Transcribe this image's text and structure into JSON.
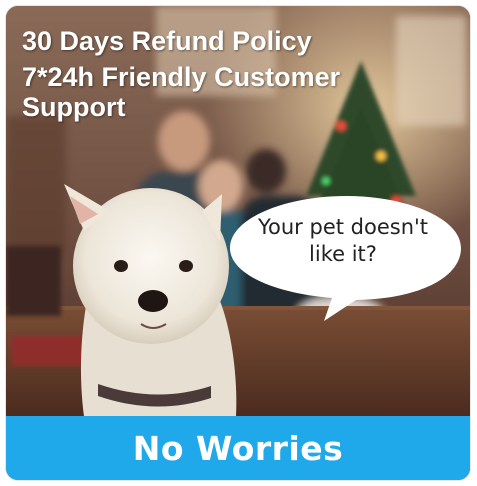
{
  "banner": {
    "headline_line1": "30 Days Refund Policy",
    "headline_line2": "7*24h Friendly Customer Support",
    "speech_bubble": "Your pet doesn't like it?",
    "bottom_label": "No Worries"
  },
  "colors": {
    "bar_blue": "#1fa9ea",
    "text_white": "#ffffff",
    "bubble_white": "#ffffff"
  },
  "icons": {
    "dog": "west-highland-terrier-illustration",
    "tree": "christmas-tree-illustration"
  }
}
